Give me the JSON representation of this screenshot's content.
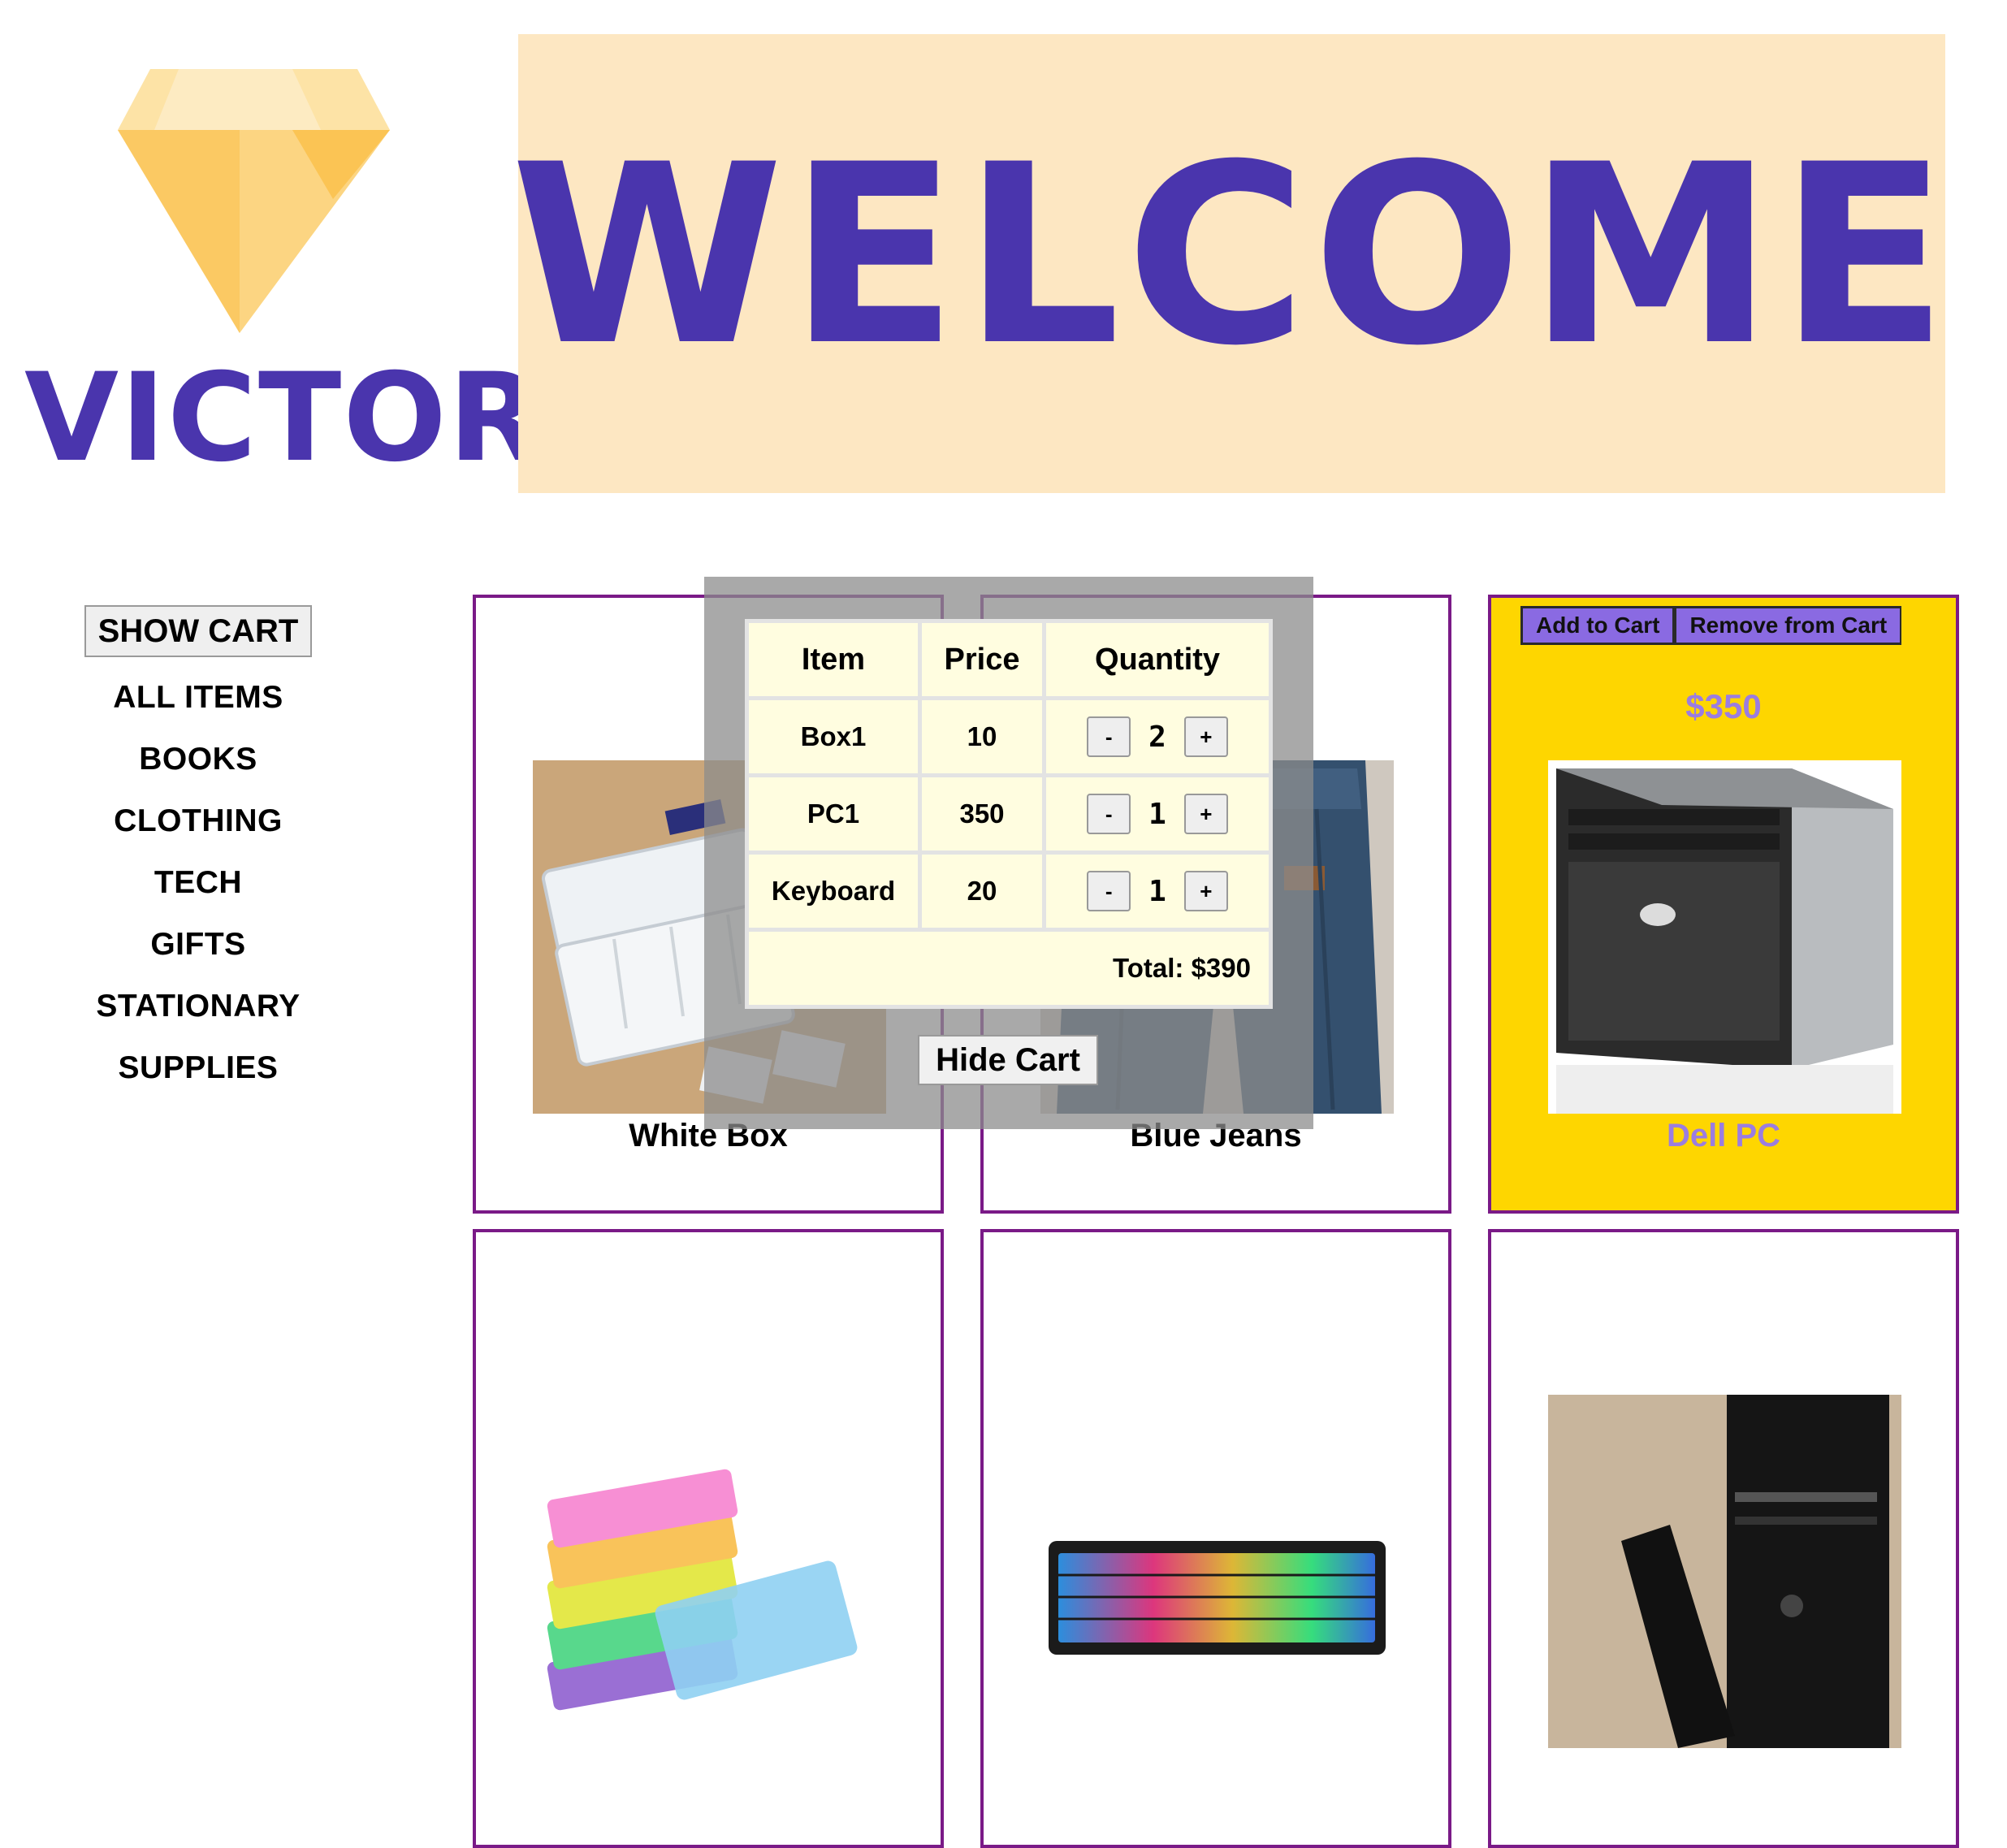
{
  "brand": {
    "name": "VICTOR"
  },
  "banner": {
    "text": "WELCOME"
  },
  "sidebar": {
    "show_cart_label": "SHOW CART",
    "nav": [
      "ALL ITEMS",
      "BOOKS",
      "CLOTHING",
      "TECH",
      "GIFTS",
      "STATIONARY",
      "SUPPLIES"
    ]
  },
  "products": [
    {
      "title": "White Box",
      "image": "white-box-photo"
    },
    {
      "title": "Blue Jeans",
      "image": "blue-jeans-photo"
    },
    {
      "title": "Dell PC",
      "price": "$350",
      "image": "dell-pc-photo",
      "add_label": "Add to Cart",
      "remove_label": "Remove from Cart"
    },
    {
      "title": "",
      "image": "colored-boxes-photo"
    },
    {
      "title": "",
      "image": "rgb-keyboard-photo"
    },
    {
      "title": "",
      "image": "desktop-pc-photo"
    }
  ],
  "cart": {
    "headers": [
      "Item",
      "Price",
      "Quantity"
    ],
    "rows": [
      {
        "item": "Box1",
        "price": "10",
        "qty": "2"
      },
      {
        "item": "PC1",
        "price": "350",
        "qty": "1"
      },
      {
        "item": "Keyboard",
        "price": "20",
        "qty": "1"
      }
    ],
    "minus": "-",
    "plus": "+",
    "total": "Total: $390",
    "hide_label": "Hide Cart"
  },
  "colors": {
    "accent_purple": "#4a35ad",
    "banner_bg": "#fde7c2",
    "card_border": "#7a1a87",
    "featured_bg": "#fed600",
    "button_purple": "#8a6ae2"
  }
}
